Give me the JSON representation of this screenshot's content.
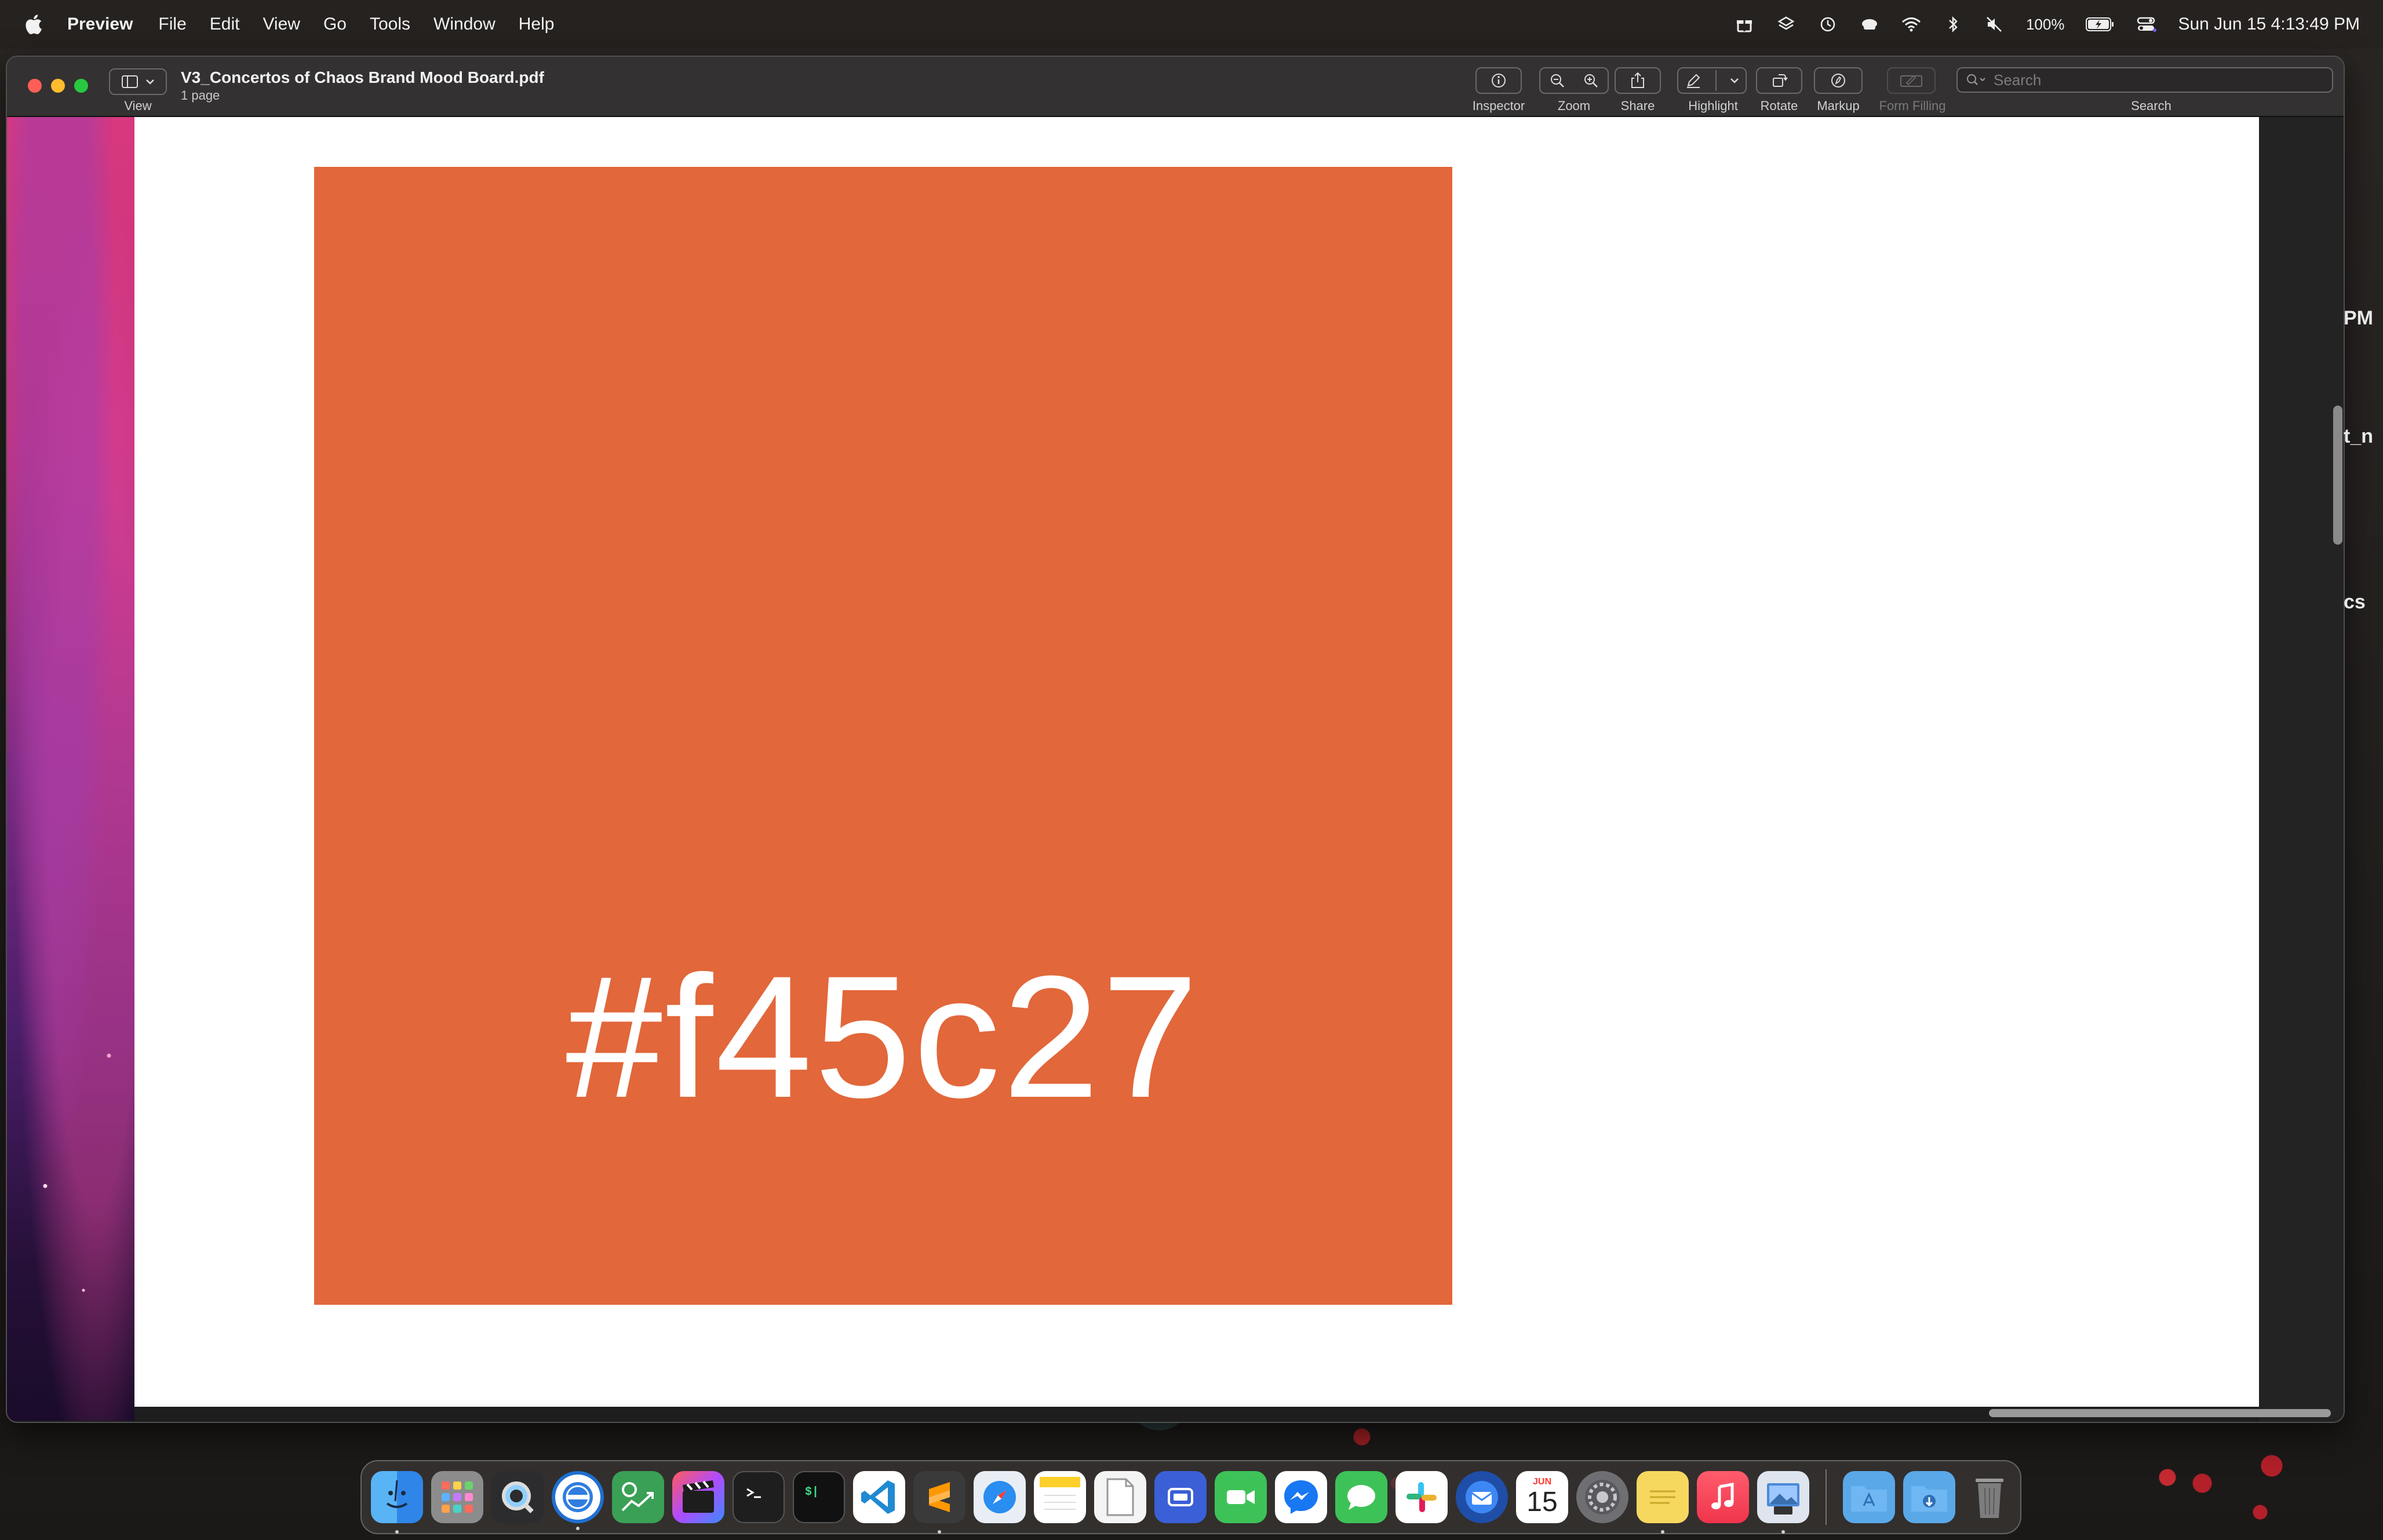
{
  "menubar": {
    "app_name": "Preview",
    "menus": [
      "File",
      "Edit",
      "View",
      "Go",
      "Tools",
      "Window",
      "Help"
    ],
    "battery": "100%",
    "clock": "Sun Jun 15  4:13:49 PM"
  },
  "window": {
    "document_title": "V3_Concertos of Chaos Brand Mood Board.pdf",
    "page_count": "1 page",
    "toolbar": {
      "view_label": "View",
      "inspector_label": "Inspector",
      "zoom_label": "Zoom",
      "share_label": "Share",
      "highlight_label": "Highlight",
      "rotate_label": "Rotate",
      "markup_label": "Markup",
      "form_filling_label": "Form Filling",
      "search_label": "Search",
      "search_placeholder": "Search"
    }
  },
  "page": {
    "swatch_color": "#e2673a",
    "swatch_label": "#f45c27"
  },
  "outside_text": {
    "pm": "PM",
    "underscore_n": "t_n",
    "cs": "cs"
  },
  "dock": {
    "calendar_month": "JUN",
    "calendar_day": "15",
    "apps": [
      "Finder",
      "Launchpad",
      "QuickTime Player",
      "Oscar",
      "O2",
      "Final Cut Pro",
      "Terminal",
      "Terminal Alt",
      "Visual Studio Code",
      "Sublime Text",
      "Safari",
      "Notes",
      "TextEdit",
      "Screen Sharing",
      "FaceTime",
      "Messenger",
      "Messages",
      "Slack",
      "Thunderbird",
      "Calendar",
      "System Settings",
      "Stickies",
      "Music",
      "Preview",
      "Applications",
      "Downloads",
      "Trash"
    ]
  }
}
